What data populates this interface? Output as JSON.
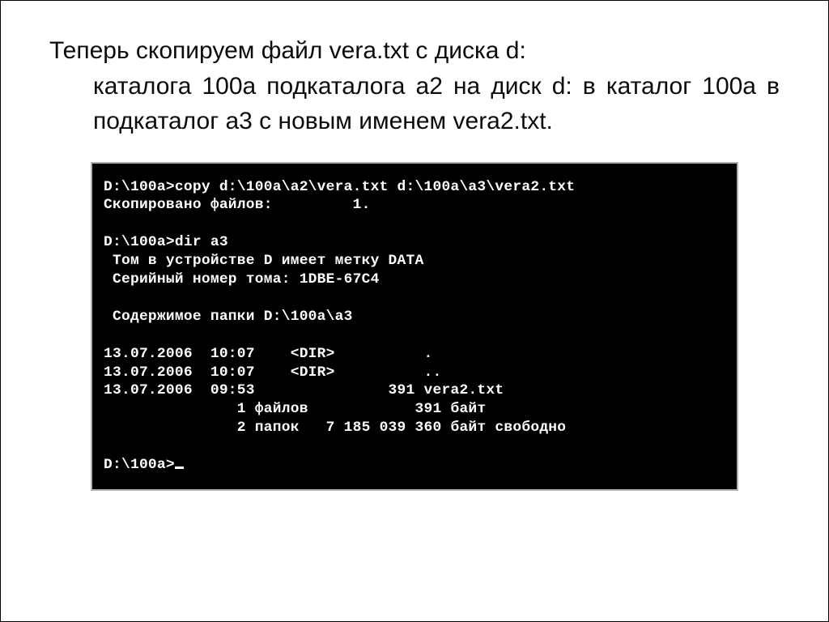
{
  "description": {
    "line1": "Теперь скопируем файл vera.txt с диска d:",
    "line2": "каталога 100a подкаталога a2 на диск d: в каталог 100a в подкаталог a3 с новым именем vera2.txt."
  },
  "terminal": {
    "l01": "D:\\100a>copy d:\\100a\\a2\\vera.txt d:\\100a\\a3\\vera2.txt",
    "l02": "Скопировано файлов:         1.",
    "l03": "",
    "l04": "D:\\100a>dir a3",
    "l05": " Том в устройстве D имеет метку DATA",
    "l06": " Серийный номер тома: 1DBE-67C4",
    "l07": "",
    "l08": " Содержимое папки D:\\100a\\a3",
    "l09": "",
    "l10": "13.07.2006  10:07    <DIR>          .",
    "l11": "13.07.2006  10:07    <DIR>          ..",
    "l12": "13.07.2006  09:53               391 vera2.txt",
    "l13": "               1 файлов            391 байт",
    "l14": "               2 папок   7 185 039 360 байт свободно",
    "l15": "",
    "l16": "D:\\100a>"
  }
}
